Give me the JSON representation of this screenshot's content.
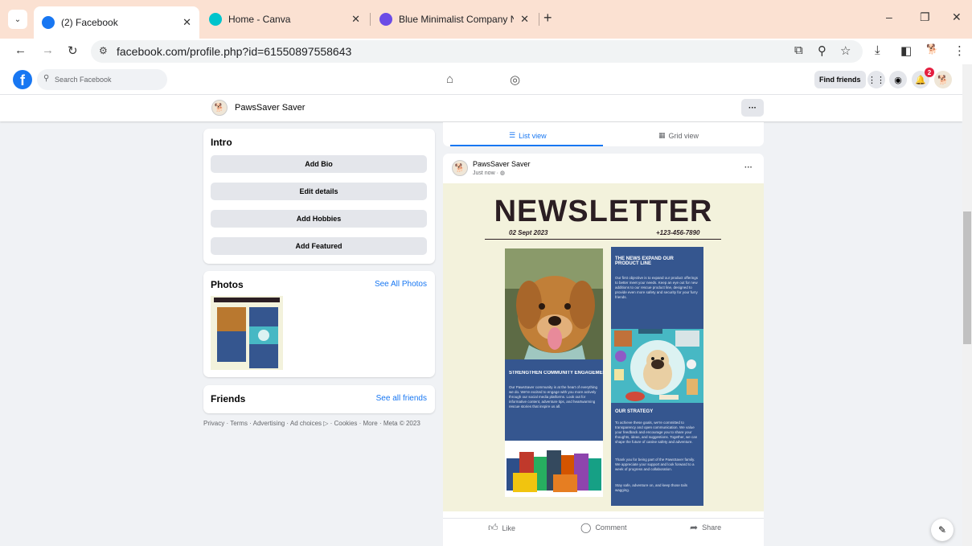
{
  "browser": {
    "tabs": [
      {
        "title": "(2) Facebook",
        "favicon_color": "#1877f2"
      },
      {
        "title": "Home - Canva",
        "favicon_color": "#00c4cc"
      },
      {
        "title": "Blue Minimalist Company New",
        "favicon_color": "#6b4ce6"
      }
    ],
    "url": "facebook.com/profile.php?id=61550897558643",
    "accent_color": "#fbe1d2"
  },
  "fb": {
    "search_placeholder": "Search Facebook",
    "find_friends": "Find friends",
    "notification_count": "2"
  },
  "profile": {
    "name": "PawsSaver Saver"
  },
  "intro": {
    "title": "Intro",
    "buttons": [
      "Add Bio",
      "Edit details",
      "Add Hobbies",
      "Add Featured"
    ]
  },
  "photos": {
    "title": "Photos",
    "link": "See All Photos"
  },
  "friends": {
    "title": "Friends",
    "link": "See all friends"
  },
  "footer": "Privacy · Terms · Advertising · Ad choices ▷ · Cookies · More · Meta © 2023",
  "views": {
    "list": "List view",
    "grid": "Grid view"
  },
  "post": {
    "author": "PawsSaver Saver",
    "time": "Just now ·",
    "actions": {
      "like": "Like",
      "comment": "Comment",
      "share": "Share"
    }
  },
  "newsletter": {
    "title": "NEWSLETTER",
    "date": "02 Sept 2023",
    "phone": "+123-456-7890",
    "sections": [
      {
        "heading": "THE NEWS EXPAND OUR PRODUCT LINE",
        "body": "Our first objective is to expand our product offerings to better meet your needs. Keep an eye out for new additions to our rescue product line, designed to provide even more safety and security for your furry friends."
      },
      {
        "heading": "STRENGTHEN COMMUNITY ENGAGEMENT",
        "body": "Our PawsSaver community is at the heart of everything we do. We're excited to engage with you more actively through our social media platforms. Look out for informative content, adventure tips, and heartwarming rescue stories that inspire us all."
      },
      {
        "heading": "OUR STRATEGY",
        "body": "To achieve these goals, we're committed to transparency and open communication. We value your feedback and encourage you to share your thoughts, ideas, and suggestions. Together, we can shape the future of canine safety and adventure.",
        "body2": "Thank you for being part of the PawsSaver family. We appreciate your support and look forward to a week of progress and collaboration.",
        "body3": "Stay safe, adventure on, and keep those tails wagging."
      }
    ],
    "colors": {
      "panel": "#35568f",
      "background": "#f3f2dc",
      "ink": "#2b1e23"
    }
  }
}
